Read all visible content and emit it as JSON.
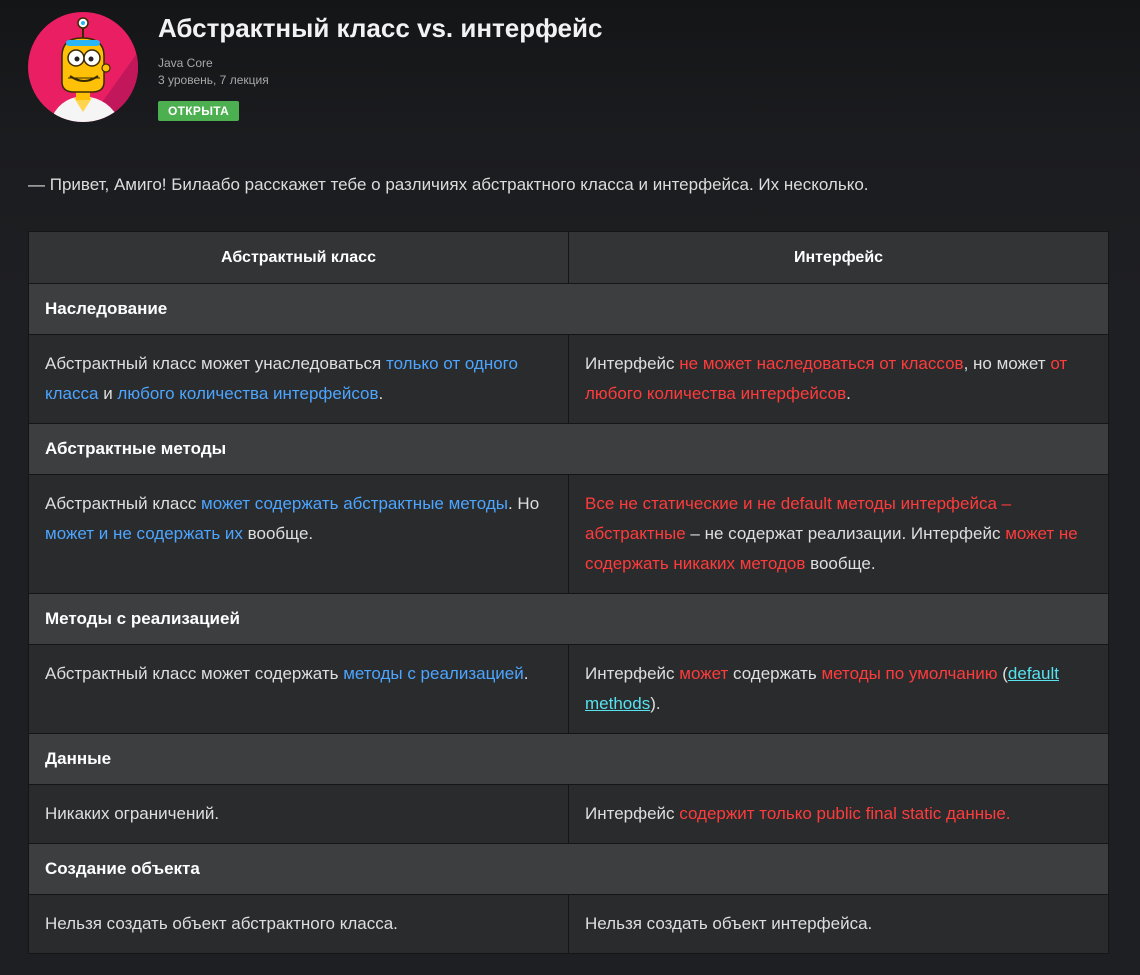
{
  "header": {
    "title": "Абстрактный класс vs. интерфейс",
    "course": "Java Core",
    "level": "3 уровень, 7 лекция",
    "status": "ОТКРЫТА",
    "avatar_icon": "robot-character-icon"
  },
  "intro": "— Привет, Амиго! Билаабо расскажет тебе о различиях абстрактного класса и интерфейса. Их несколько.",
  "table": {
    "headers": [
      "Абстрактный класс",
      "Интерфейс"
    ],
    "rows": [
      {
        "section": "Наследование",
        "left": [
          {
            "t": "Абстрактный класс может унаследоваться ",
            "c": ""
          },
          {
            "t": "только от одного класса",
            "c": "b"
          },
          {
            "t": " и ",
            "c": ""
          },
          {
            "t": "любого количества интерфейсов",
            "c": "b"
          },
          {
            "t": ".",
            "c": ""
          }
        ],
        "right": [
          {
            "t": "Интерфейс ",
            "c": ""
          },
          {
            "t": "не может наследоваться от классов",
            "c": "r"
          },
          {
            "t": ", но может ",
            "c": ""
          },
          {
            "t": "от любого количества интерфейсов",
            "c": "r"
          },
          {
            "t": ".",
            "c": ""
          }
        ]
      },
      {
        "section": "Абстрактные методы",
        "left": [
          {
            "t": "Абстрактный класс ",
            "c": ""
          },
          {
            "t": "может содержать абстрактные методы",
            "c": "b"
          },
          {
            "t": ". Но ",
            "c": ""
          },
          {
            "t": "может и не содержать их",
            "c": "b"
          },
          {
            "t": " вообще.",
            "c": ""
          }
        ],
        "right": [
          {
            "t": "Все не статические и не default методы интерфейса – абстрактные",
            "c": "r"
          },
          {
            "t": " – не содержат реализации. Интерфейс ",
            "c": ""
          },
          {
            "t": "может не содержать никаких методов",
            "c": "r"
          },
          {
            "t": " вообще.",
            "c": ""
          }
        ]
      },
      {
        "section": "Методы с реализацией",
        "left": [
          {
            "t": "Абстрактный класс может содержать ",
            "c": ""
          },
          {
            "t": "методы с реализацией",
            "c": "b"
          },
          {
            "t": ".",
            "c": ""
          }
        ],
        "right": [
          {
            "t": "Интерфейс ",
            "c": ""
          },
          {
            "t": "может",
            "c": "r"
          },
          {
            "t": " содержать ",
            "c": ""
          },
          {
            "t": "методы по умолчанию",
            "c": "r"
          },
          {
            "t": " (",
            "c": ""
          },
          {
            "t": "default methods",
            "c": "lnk"
          },
          {
            "t": ").",
            "c": ""
          }
        ]
      },
      {
        "section": "Данные",
        "left": [
          {
            "t": "Никаких ограничений.",
            "c": ""
          }
        ],
        "right": [
          {
            "t": "Интерфейс ",
            "c": ""
          },
          {
            "t": "содержит только public final static данные.",
            "c": "r"
          }
        ]
      },
      {
        "section": "Создание объекта",
        "left": [
          {
            "t": "Нельзя создать объект абстрактного класса.",
            "c": ""
          }
        ],
        "right": [
          {
            "t": "Нельзя создать объект интерфейса.",
            "c": ""
          }
        ]
      }
    ]
  }
}
